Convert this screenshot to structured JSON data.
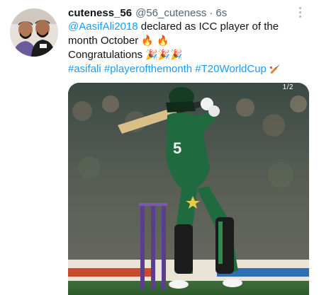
{
  "tweet": {
    "display_name": "cuteness_56",
    "handle": "@56_cuteness",
    "separator": "·",
    "time": "6s",
    "mention": "@AasifAli2018",
    "text_part1": " declared as ICC player of the",
    "text_part2": "month October ",
    "fire_emoji": "🔥",
    "congrats": "Congratulations ",
    "party_emoji": "🎉",
    "hashtags": [
      "#asifali",
      "#playerofthemonth",
      "#T20WorldCup"
    ],
    "cricket_emoji": "🏏",
    "media_counter": "1/2"
  },
  "colors": {
    "link": "#1d9bf0",
    "text": "#0f1419",
    "muted": "#536471",
    "jersey_green": "#1f6b3f"
  },
  "icons": {
    "more": "more-dots-vertical-icon"
  }
}
